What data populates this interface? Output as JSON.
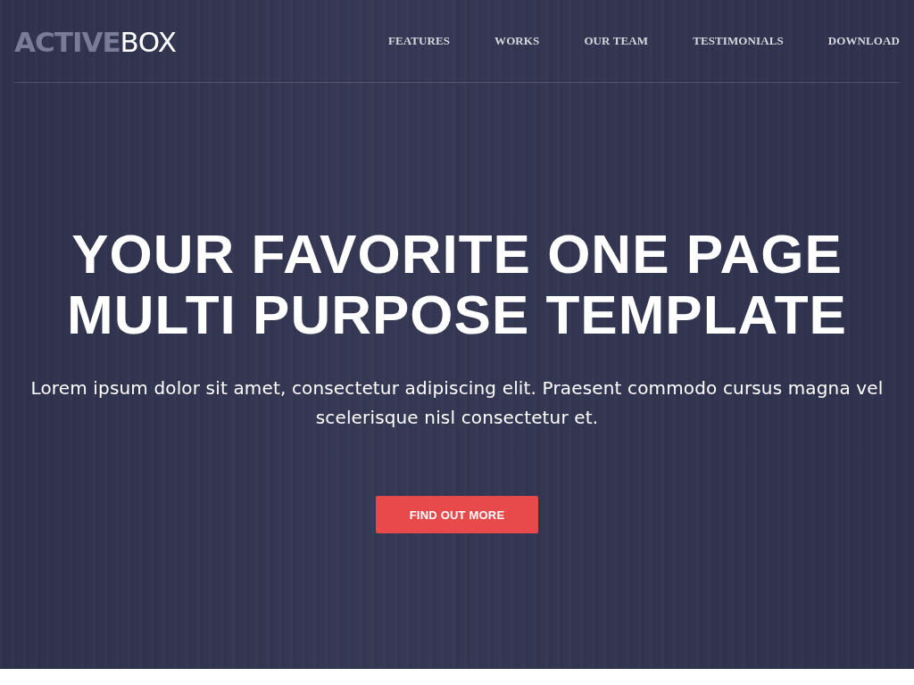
{
  "header": {
    "logo": "**ACTIVE**BOX",
    "nav": [
      "FEATURES",
      "WORKS",
      "OUR TEAM",
      "TESTIMONIALS",
      "DOWNLOAD"
    ]
  },
  "hero": {
    "title_lines": [
      "YOUR FAVORITE ONE PAGE",
      "MULTI PURPOSE TEMPLATE"
    ],
    "text": "Lorem ipsum dolor sit amet, consectetur adipiscing elit. Praesent commodo cursus magna vel scelerisque nisl consectetur et.",
    "button": "FIND OUT MORE"
  }
}
